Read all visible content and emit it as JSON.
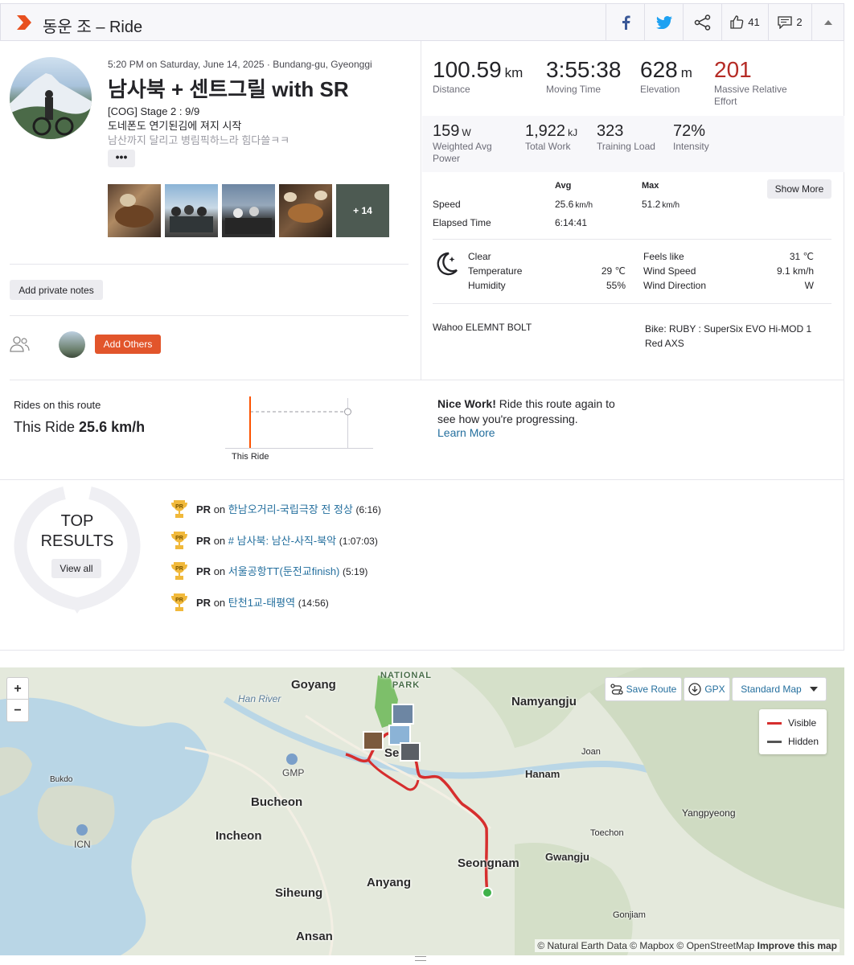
{
  "header": {
    "title": "동운 조 – Ride",
    "kudos_count": "41",
    "comments_count": "2"
  },
  "activity": {
    "meta": "5:20 PM on Saturday, June 14, 2025 · Bundang-gu, Gyeonggi",
    "title": "남사북 + 센트그릴 with SR",
    "description_line1": "[COG] Stage 2 : 9/9",
    "description_line2": "도네폰도 연기된김에 져지 시작",
    "description_line3": "남산까지 달리고 병림픽하느라 힘다쓸ㅋㅋ",
    "more_label": "•••",
    "photos_more": "+ 14",
    "private_notes_label": "Add private notes",
    "add_others_label": "Add Others"
  },
  "stats": {
    "distance_value": "100.59",
    "distance_unit": "km",
    "distance_label": "Distance",
    "moving_time_value": "3:55:38",
    "moving_time_label": "Moving Time",
    "elevation_value": "628",
    "elevation_unit": "m",
    "elevation_label": "Elevation",
    "relative_effort_value": "201",
    "relative_effort_label": "Massive Relative Effort",
    "power_value": "159",
    "power_unit": "W",
    "power_label": "Weighted Avg Power",
    "work_value": "1,922",
    "work_unit": "kJ",
    "work_label": "Total Work",
    "training_load_value": "323",
    "training_load_label": "Training Load",
    "intensity_value": "72%",
    "intensity_label": "Intensity"
  },
  "details": {
    "avg_header": "Avg",
    "max_header": "Max",
    "show_more_label": "Show More",
    "speed_label": "Speed",
    "speed_avg": "25.6",
    "speed_max": "51.2",
    "speed_unit": "km/h",
    "elapsed_label": "Elapsed Time",
    "elapsed_value": "6:14:41"
  },
  "weather": {
    "condition": "Clear",
    "temperature_label": "Temperature",
    "temperature_value": "29 ℃",
    "humidity_label": "Humidity",
    "humidity_value": "55%",
    "feels_like_label": "Feels like",
    "feels_like_value": "31 ℃",
    "wind_speed_label": "Wind Speed",
    "wind_speed_value": "9.1 km/h",
    "wind_direction_label": "Wind Direction",
    "wind_direction_value": "W"
  },
  "gear": {
    "device": "Wahoo ELEMNT BOLT",
    "bike": "Bike: RUBY : SuperSix EVO Hi-MOD 1 Red AXS"
  },
  "route_compare": {
    "label": "Rides on this route",
    "this_ride_prefix": "This Ride",
    "this_ride_speed": "25.6 km/h",
    "chart_label": "This Ride",
    "nice_work_bold": "Nice Work!",
    "nice_work_text": " Ride this route again to see how you're progressing.",
    "learn_more": "Learn More"
  },
  "top_results": {
    "title_line1": "TOP",
    "title_line2": "RESULTS",
    "view_all": "View all",
    "items": [
      {
        "badge": "PR",
        "on": "on",
        "segment": "한남오거리-국립극장 전 정상",
        "time": "(6:16)"
      },
      {
        "badge": "PR",
        "on": "on",
        "segment": "# 남사북: 남산-사직-북악",
        "time": "(1:07:03)"
      },
      {
        "badge": "PR",
        "on": "on",
        "segment": "서울공항TT(둔전교finish)",
        "time": "(5:19)"
      },
      {
        "badge": "PR",
        "on": "on",
        "segment": "탄천1교-태평역",
        "time": "(14:56)"
      }
    ]
  },
  "map": {
    "zoom_in": "+",
    "zoom_out": "−",
    "save_route": "Save Route",
    "gpx": "GPX",
    "map_type": "Standard Map",
    "legend_visible": "Visible",
    "legend_hidden": "Hidden",
    "attribution_1": "© Natural Earth Data © Mapbox © OpenStreetMap ",
    "attribution_2": "Improve this map",
    "labels": {
      "national_park_1": "NATIONAL",
      "national_park_2": "PARK",
      "goyang": "Goyang",
      "han_river": "Han River",
      "namyangju": "Namyangju",
      "gmp": "GMP",
      "joan": "Joan",
      "hanam": "Hanam",
      "bukdo": "Bukdo",
      "bucheon": "Bucheon",
      "yangpyeong": "Yangpyeong",
      "icn": "ICN",
      "incheon": "Incheon",
      "toechon": "Toechon",
      "gwangju": "Gwangju",
      "seongnam": "Seongnam",
      "anyang": "Anyang",
      "siheung": "Siheung",
      "gonjiam": "Gonjiam",
      "ansan": "Ansan",
      "seoul_partial": "Se"
    },
    "colors": {
      "visible": "#d62e2e",
      "hidden": "#555555",
      "start": "#3fb24a"
    }
  },
  "colors": {
    "brand": "#fc5200",
    "relative_effort": "#b52b25",
    "link": "#246f9e"
  }
}
